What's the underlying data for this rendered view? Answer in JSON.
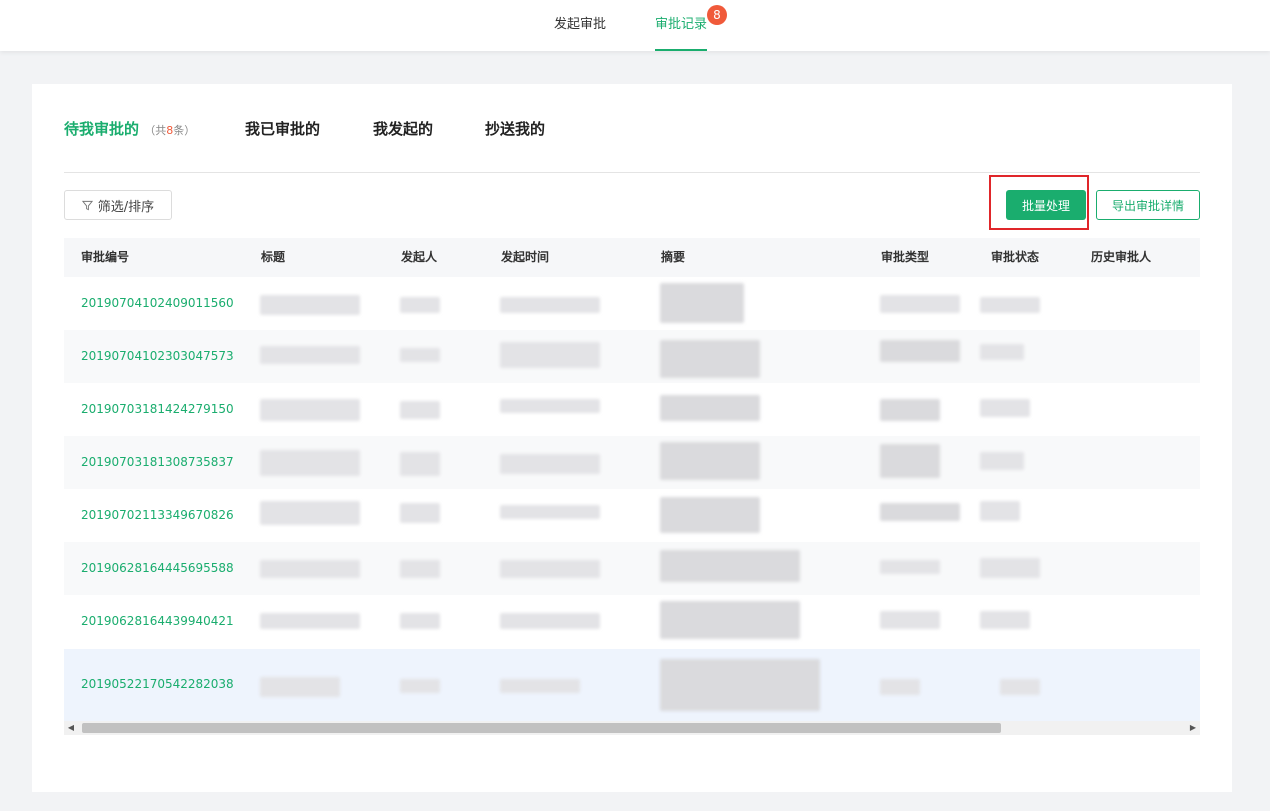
{
  "top_tabs": [
    {
      "label": "发起审批"
    },
    {
      "label": "审批记录",
      "badge": "8"
    }
  ],
  "sub_tabs": {
    "pending": {
      "label": "待我审批的",
      "count_prefix": "（共",
      "count": "8",
      "count_suffix": "条）"
    },
    "approved": {
      "label": "我已审批的"
    },
    "initiated": {
      "label": "我发起的"
    },
    "cc": {
      "label": "抄送我的"
    }
  },
  "toolbar": {
    "filter_label": "筛选/排序",
    "batch_label": "批量处理",
    "export_label": "导出审批详情"
  },
  "table": {
    "columns": [
      "审批编号",
      "标题",
      "发起人",
      "发起时间",
      "摘要",
      "审批类型",
      "审批状态",
      "历史审批人"
    ],
    "rows": [
      {
        "id": "20190704102409011560"
      },
      {
        "id": "20190704102303047573"
      },
      {
        "id": "20190703181424279150"
      },
      {
        "id": "20190703181308735837"
      },
      {
        "id": "20190702113349670826"
      },
      {
        "id": "20190628164445695588"
      },
      {
        "id": "20190628164439940421"
      },
      {
        "id": "20190522170542282038"
      }
    ]
  },
  "colors": {
    "accent": "#1aad6e",
    "badge": "#f05a3a",
    "highlight_border": "#e0262a"
  }
}
